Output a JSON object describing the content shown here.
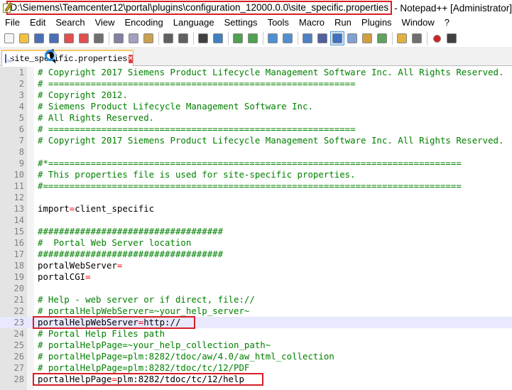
{
  "window": {
    "title_path": "D:\\Siemens\\Teamcenter12\\portal\\plugins\\configuration_12000.0.0\\site_specific.properties",
    "title_rest": "- Notepad++ [Administrator]"
  },
  "menu": [
    "File",
    "Edit",
    "Search",
    "View",
    "Encoding",
    "Language",
    "Settings",
    "Tools",
    "Macro",
    "Run",
    "Plugins",
    "Window",
    "?"
  ],
  "toolbar": {
    "buttons": [
      {
        "name": "new-file-icon",
        "color": "#f5f5f5"
      },
      {
        "name": "open-file-icon",
        "color": "#f0c040"
      },
      {
        "name": "save-icon",
        "color": "#4a6fb5"
      },
      {
        "name": "save-all-icon",
        "color": "#4a6fb5"
      },
      {
        "name": "close-icon",
        "color": "#e05050"
      },
      {
        "name": "close-all-icon",
        "color": "#e05050"
      },
      {
        "name": "print-icon",
        "color": "#707070"
      },
      {
        "name": "cut-icon",
        "color": "#8080a0"
      },
      {
        "name": "copy-icon",
        "color": "#a0a0c0"
      },
      {
        "name": "paste-icon",
        "color": "#c8a050"
      },
      {
        "name": "undo-icon",
        "color": "#606060"
      },
      {
        "name": "redo-icon",
        "color": "#606060"
      },
      {
        "name": "find-icon",
        "color": "#404040"
      },
      {
        "name": "replace-icon",
        "color": "#4080c0"
      },
      {
        "name": "zoom-in-icon",
        "color": "#50a050"
      },
      {
        "name": "zoom-out-icon",
        "color": "#50a050"
      },
      {
        "name": "sync-vertical-icon",
        "color": "#5090d0"
      },
      {
        "name": "sync-horizontal-icon",
        "color": "#5090d0"
      },
      {
        "name": "word-wrap-icon",
        "color": "#5080c0"
      },
      {
        "name": "show-all-chars-icon",
        "color": "#5060a0"
      },
      {
        "name": "indent-guide-icon",
        "color": "#4070c0"
      },
      {
        "name": "udl-icon",
        "color": "#80a0d0"
      },
      {
        "name": "doc-map-icon",
        "color": "#d0a040"
      },
      {
        "name": "function-list-icon",
        "color": "#60a060"
      },
      {
        "name": "folder-as-workspace-icon",
        "color": "#e0b040"
      },
      {
        "name": "monitoring-icon",
        "color": "#707070"
      },
      {
        "name": "record-macro-icon",
        "color": "#d02020"
      },
      {
        "name": "stop-record-icon",
        "color": "#404040"
      }
    ]
  },
  "tab": {
    "label": "site_specific.properties",
    "close_symbol": "×"
  },
  "editor": {
    "lines": [
      {
        "n": "1",
        "type": "comment",
        "text": "# Copyright 2017 Siemens Product Lifecycle Management Software Inc. All Rights Reserved."
      },
      {
        "n": "2",
        "type": "comment",
        "text": "# =========================================================="
      },
      {
        "n": "3",
        "type": "comment",
        "text": "# Copyright 2012."
      },
      {
        "n": "4",
        "type": "comment",
        "text": "# Siemens Product Lifecycle Management Software Inc."
      },
      {
        "n": "5",
        "type": "comment",
        "text": "# All Rights Reserved."
      },
      {
        "n": "6",
        "type": "comment",
        "text": "# =========================================================="
      },
      {
        "n": "7",
        "type": "comment",
        "text": "# Copyright 2017 Siemens Product Lifecycle Management Software Inc. All Rights Reserved."
      },
      {
        "n": "8",
        "type": "blank",
        "text": ""
      },
      {
        "n": "9",
        "type": "comment",
        "text": "#*=============================================================================="
      },
      {
        "n": "10",
        "type": "comment",
        "text": "# This properties file is used for site-specific properties."
      },
      {
        "n": "11",
        "type": "comment",
        "text": "#==============================================================================="
      },
      {
        "n": "12",
        "type": "blank",
        "text": ""
      },
      {
        "n": "13",
        "type": "prop",
        "key": "import",
        "value": "client_specific"
      },
      {
        "n": "14",
        "type": "blank",
        "text": ""
      },
      {
        "n": "15",
        "type": "comment",
        "text": "###################################"
      },
      {
        "n": "16",
        "type": "comment",
        "text": "#  Portal Web Server location"
      },
      {
        "n": "17",
        "type": "comment",
        "text": "###################################"
      },
      {
        "n": "18",
        "type": "prop",
        "key": "portalWebServer",
        "value": ""
      },
      {
        "n": "19",
        "type": "prop",
        "key": "portalCGI",
        "value": ""
      },
      {
        "n": "20",
        "type": "blank",
        "text": ""
      },
      {
        "n": "21",
        "type": "comment",
        "text": "# Help - web server or if direct, file://"
      },
      {
        "n": "22",
        "type": "comment",
        "text": "# portalHelpWebServer=~your_help_server~"
      },
      {
        "n": "23",
        "type": "prop",
        "key": "portalHelpWebServer",
        "value": "http://",
        "current": true
      },
      {
        "n": "24",
        "type": "comment",
        "text": "# Portal Help Files path"
      },
      {
        "n": "25",
        "type": "comment",
        "text": "# portalHelpPage=~your_help_collection_path~"
      },
      {
        "n": "26",
        "type": "comment",
        "text": "# portalHelpPage=plm:8282/tdoc/aw/4.0/aw_html_collection"
      },
      {
        "n": "27",
        "type": "comment",
        "text": "# portalHelpPage=plm:8282/tdoc/tc/12/PDF"
      },
      {
        "n": "28",
        "type": "prop",
        "key": "portalHelpPage",
        "value": "plm:8282/tdoc/tc/12/help"
      }
    ]
  }
}
